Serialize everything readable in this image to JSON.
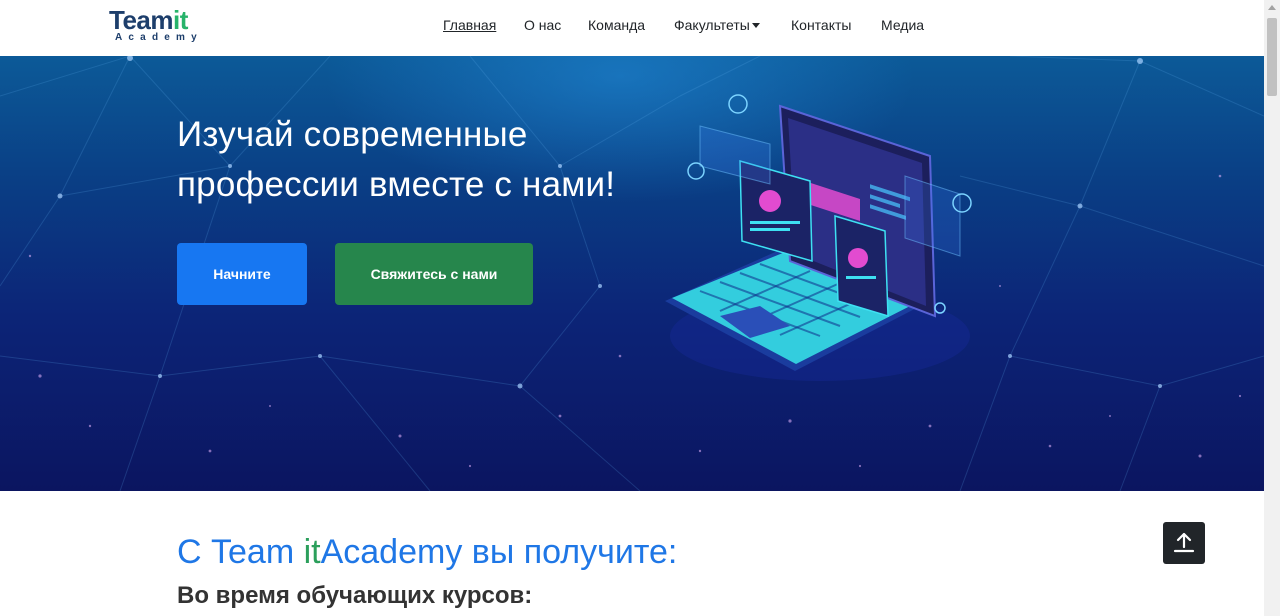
{
  "brand": {
    "logo_team": "Team",
    "logo_it": "it",
    "logo_sub": "Academy",
    "colors": {
      "team": "#1d3e6b",
      "it": "#27b36a"
    }
  },
  "nav": {
    "items": [
      {
        "label": "Главная",
        "active": true
      },
      {
        "label": "О нас"
      },
      {
        "label": "Команда"
      },
      {
        "label": "Факультеты",
        "dropdown": true
      },
      {
        "label": "Контакты"
      },
      {
        "label": "Медиа"
      }
    ]
  },
  "hero": {
    "title": "Изучай современные профессии вместе с нами!",
    "buttons": {
      "start": "Начните",
      "contact": "Свяжитесь с нами"
    },
    "colors": {
      "start": "#1777f2",
      "contact": "#26864c"
    }
  },
  "section": {
    "title_prefix": "С Team ",
    "title_it": "it",
    "title_suffix": "Academy вы получите:",
    "subtitle": "Во время обучающих курсов:"
  },
  "icons": {
    "to_top": "arrow-up-to-line-icon",
    "dropdown": "caret-down-icon"
  }
}
